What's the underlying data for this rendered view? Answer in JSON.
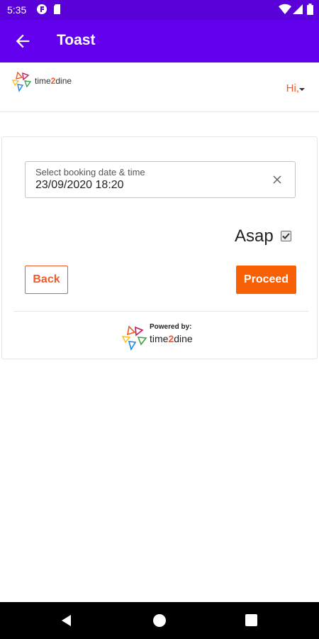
{
  "status_bar": {
    "time": "5:35",
    "icons": [
      "notification-f-icon",
      "sim-card-icon",
      "wifi-icon",
      "signal-icon",
      "battery-icon"
    ]
  },
  "app_bar": {
    "title": "Toast",
    "back_icon": "arrow-left-icon",
    "color": "#6200ee"
  },
  "header": {
    "logo_text_prefix": "time",
    "logo_text_accent": "2",
    "logo_text_suffix": "dine",
    "greeting": "Hi,",
    "accent_color": "#f05a28"
  },
  "booking": {
    "date_label": "Select booking date & time",
    "date_value": "23/09/2020 18:20",
    "clear_icon": "close-icon",
    "asap_label": "Asap",
    "asap_checked": true
  },
  "actions": {
    "back_label": "Back",
    "proceed_label": "Proceed",
    "proceed_color": "#f86005"
  },
  "footer": {
    "powered_by": "Powered by:",
    "brand_prefix": "time",
    "brand_accent": "2",
    "brand_suffix": "dine"
  },
  "nav_bar": {
    "icons": [
      "nav-back-icon",
      "nav-home-icon",
      "nav-recents-icon"
    ]
  }
}
